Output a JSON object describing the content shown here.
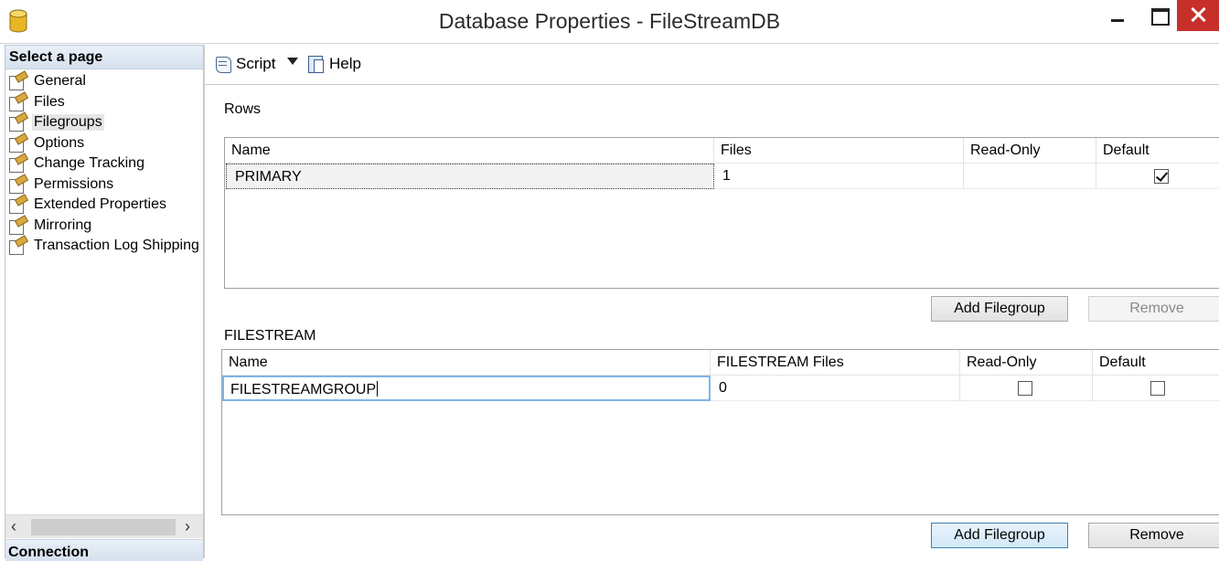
{
  "window": {
    "title": "Database Properties - FileStreamDB"
  },
  "left_pane": {
    "header": "Select a page",
    "pages": [
      {
        "label": "General"
      },
      {
        "label": "Files"
      },
      {
        "label": "Filegroups",
        "selected": true
      },
      {
        "label": "Options"
      },
      {
        "label": "Change Tracking"
      },
      {
        "label": "Permissions"
      },
      {
        "label": "Extended Properties"
      },
      {
        "label": "Mirroring"
      },
      {
        "label": "Transaction Log Shipping"
      }
    ],
    "connection_header": "Connection"
  },
  "toolbar": {
    "script_label": "Script",
    "help_label": "Help"
  },
  "rows_section": {
    "label": "Rows",
    "columns": [
      "Name",
      "Files",
      "Read-Only",
      "Default"
    ],
    "rows": [
      {
        "name": "PRIMARY",
        "files": "1",
        "read_only": false,
        "default": true
      }
    ],
    "add_button": "Add Filegroup",
    "remove_button": "Remove"
  },
  "filestream_section": {
    "label": "FILESTREAM",
    "columns": [
      "Name",
      "FILESTREAM Files",
      "Read-Only",
      "Default"
    ],
    "rows": [
      {
        "name": "FILESTREAMGROUP",
        "files": "0",
        "read_only": false,
        "default": false
      }
    ],
    "add_button": "Add Filegroup",
    "remove_button": "Remove"
  },
  "colors": {
    "close_button": "#c7302a",
    "pane_header": "#d5e1ee",
    "edit_border": "#7eb4ea"
  }
}
